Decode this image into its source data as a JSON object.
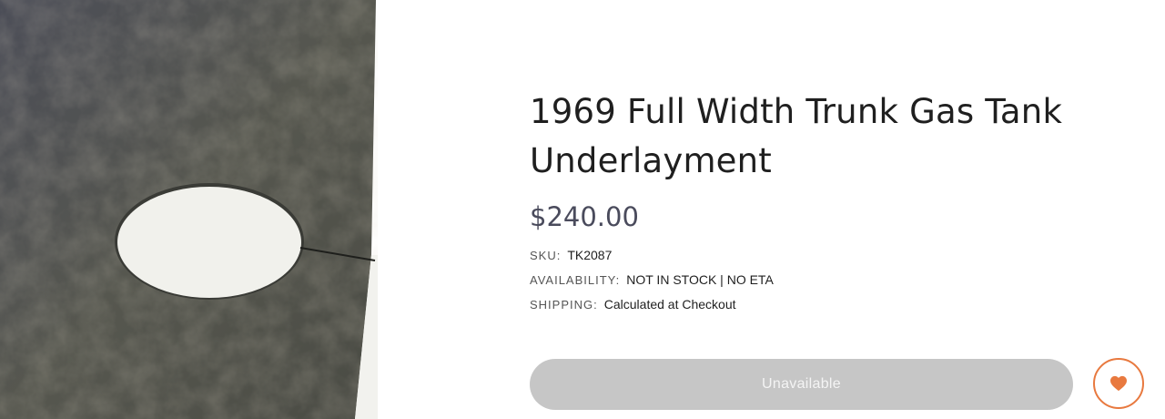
{
  "product": {
    "title": "1969 Full Width Trunk Gas Tank Underlayment",
    "price": "$240.00",
    "image_alt": "trunk-underlayment-photo",
    "meta": [
      {
        "label": "SKU:",
        "value": "TK2087"
      },
      {
        "label": "AVAILABILITY:",
        "value": "NOT IN STOCK | NO ETA"
      },
      {
        "label": "SHIPPING:",
        "value": "Calculated at Checkout"
      }
    ]
  },
  "actions": {
    "add_to_cart_label": "Unavailable",
    "wishlist_icon": "heart-icon"
  },
  "colors": {
    "accent": "#e8793f",
    "button_disabled": "#c6c6c6",
    "price": "#4a4b5c"
  }
}
